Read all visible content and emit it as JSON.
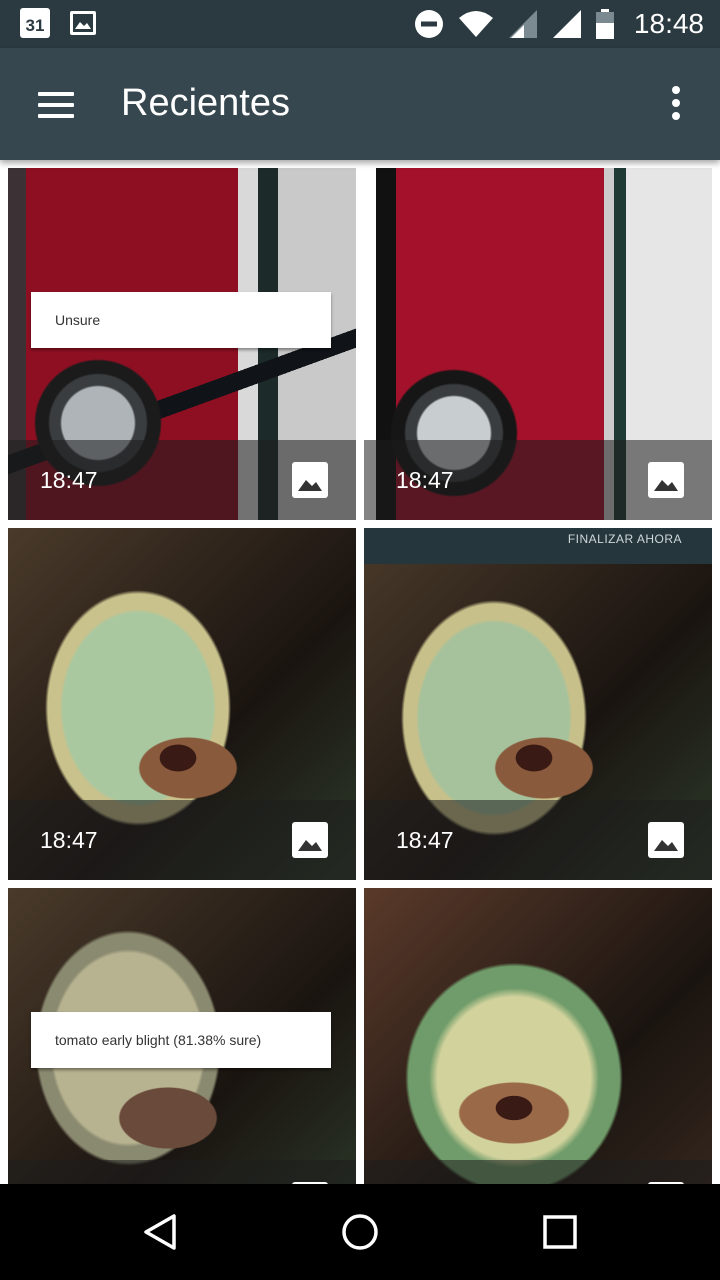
{
  "status_bar": {
    "calendar_day": "31",
    "time": "18:48",
    "icons": [
      "calendar-icon",
      "image-notification-icon",
      "do-not-disturb-icon",
      "wifi-icon",
      "signal-icon",
      "signal-icon",
      "battery-icon"
    ]
  },
  "app_bar": {
    "title": "Recientes",
    "menu_icon": "hamburger-menu-icon",
    "more_icon": "more-vert-icon"
  },
  "grid": {
    "items": [
      {
        "time": "18:47",
        "label": "Unsure",
        "type_icon": "image-icon"
      },
      {
        "time": "18:47",
        "type_icon": "image-icon"
      },
      {
        "time": "18:47",
        "type_icon": "image-icon"
      },
      {
        "time": "18:47",
        "banner": "FINALIZAR AHORA",
        "type_icon": "image-icon"
      },
      {
        "label": "tomato early blight (81.38% sure)",
        "type_icon": "image-icon"
      },
      {
        "type_icon": "image-icon"
      }
    ]
  },
  "nav_bar": {
    "icons": [
      "back-icon",
      "home-icon",
      "recents-icon"
    ]
  },
  "colors": {
    "status_bar": "#2b3a40",
    "app_bar": "#37474f",
    "nav_bar": "#000000"
  }
}
